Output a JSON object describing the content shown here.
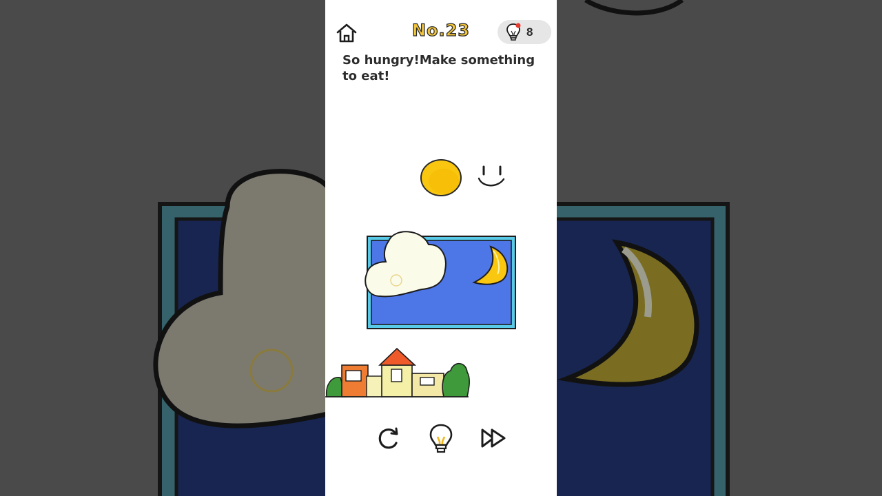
{
  "level": {
    "title": "No.23",
    "question": "So hungry!Make something to eat!"
  },
  "hints": {
    "count": "8"
  },
  "scene": {
    "items": [
      "yellow-ball",
      "smiley-face",
      "night-window",
      "cloud",
      "moon",
      "town-houses"
    ],
    "colors": {
      "sky": "#4d76e6",
      "frame": "#58c9e6",
      "ball": "#f9c70f",
      "cloud": "#fbfbe9",
      "moon": "#f9c70f"
    }
  },
  "controls": {
    "icons": [
      "home-icon",
      "lightbulb-icon",
      "restart-icon",
      "hint-icon",
      "skip-icon"
    ]
  }
}
